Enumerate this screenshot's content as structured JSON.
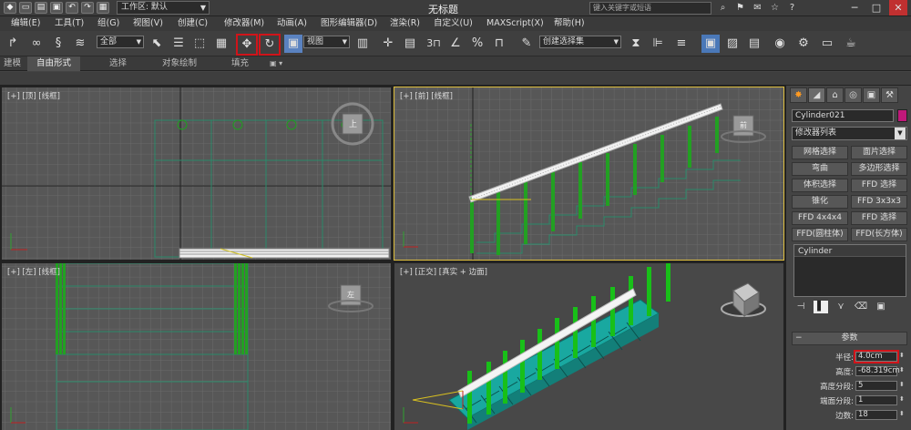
{
  "titlebar": {
    "workspace_label": "工作区: 默认",
    "app_title": "无标题",
    "search_placeholder": "键入关键字或短语"
  },
  "menu": [
    "编辑(E)",
    "工具(T)",
    "组(G)",
    "视图(V)",
    "创建(C)",
    "修改器(M)",
    "动画(A)",
    "图形编辑器(D)",
    "渲染(R)",
    "自定义(U)",
    "MAXScript(X)",
    "帮助(H)"
  ],
  "toolbar": {
    "selection_filter": "全部",
    "ref_coord": "视图",
    "named_selection": "创建选择集",
    "snap_value": "3",
    "highlighted": [
      "move-tool",
      "rotate-tool"
    ]
  },
  "ribbon": {
    "tabs": [
      "建模",
      "自由形式",
      "选择",
      "对象绘制",
      "填充"
    ],
    "active": "自由形式"
  },
  "viewports": {
    "top": {
      "label": "[+] [顶] [线框]",
      "cube": "上"
    },
    "front": {
      "label": "[+] [前] [线框]",
      "cube": "前"
    },
    "left": {
      "label": "[+] [左] [线框]",
      "cube": "左"
    },
    "persp": {
      "label": "[+] [正交] [真实 + 边面]"
    }
  },
  "command_panel": {
    "object_name": "Cylinder021",
    "object_color": "#c0187a",
    "modifier_list": "修改器列表",
    "modifier_buttons": [
      "网格选择",
      "面片选择",
      "弯曲",
      "多边形选择",
      "体积选择",
      "FFD 选择",
      "锥化",
      "FFD 3x3x3",
      "FFD 4x4x4",
      "FFD 选择",
      "FFD(圆柱体)",
      "FFD(长方体)"
    ],
    "stack_items": [
      "Cylinder"
    ],
    "params_title": "参数",
    "params": [
      {
        "label": "半径:",
        "value": "4.0cm",
        "highlight": true
      },
      {
        "label": "高度:",
        "value": "-68.319cm"
      },
      {
        "label": "高度分段:",
        "value": "5"
      },
      {
        "label": "端面分段:",
        "value": "1"
      },
      {
        "label": "边数:",
        "value": "18"
      }
    ]
  }
}
